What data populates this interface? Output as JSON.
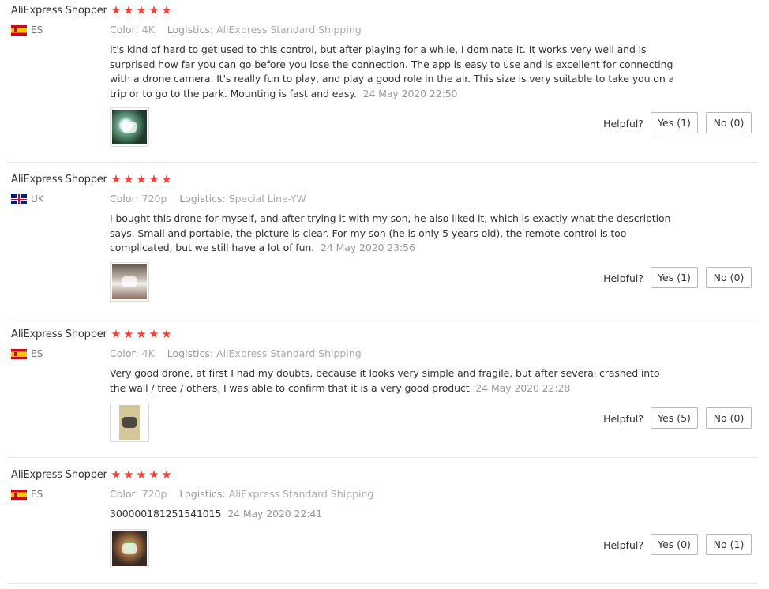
{
  "labels": {
    "color": "Color:",
    "logistics": "Logistics:",
    "helpful": "Helpful?"
  },
  "colors": {
    "star": "#f44336",
    "meta_text": "#999999",
    "body_text": "#333333",
    "button_border": "#b8b8b8"
  },
  "reviews": [
    {
      "author": "AliExpress Shopper",
      "rating": 5,
      "country": "ES",
      "flag_icon": "spain-flag-icon",
      "color": "4K",
      "logistics": "AliExpress Standard Shipping",
      "text": "It's kind of hard to get used to this control, but after playing for a while, I dominate it. It works very well and is surprised how far you can go before you lose the connection. The app is easy to use and is excellent for connecting with a drone camera. It's really fun to play, and play a good role in the air. This size is very suitable to take you on a trip or to go to the park. Mounting is fast and easy.",
      "date": "24 May 2020 22:50",
      "yes_label": "Yes (1)",
      "no_label": "No (0)"
    },
    {
      "author": "AliExpress Shopper",
      "rating": 5,
      "country": "UK",
      "flag_icon": "uk-flag-icon",
      "color": "720p",
      "logistics": "Special Line-YW",
      "text": "I bought this drone for myself, and after trying it with my son, he also liked it, which is exactly what the description says. Small and portable, the picture is clear. For my son (he is only 5 years old), the remote control is too complicated, but we still have a lot of fun.",
      "date": "24 May 2020 23:56",
      "yes_label": "Yes (1)",
      "no_label": "No (0)"
    },
    {
      "author": "AliExpress Shopper",
      "rating": 5,
      "country": "ES",
      "flag_icon": "spain-flag-icon",
      "color": "4K",
      "logistics": "AliExpress Standard Shipping",
      "text": "Very good drone, at first I had my doubts, because it looks very simple and fragile, but after several crashed into the wall / tree / others, I was able to confirm that it is a very good product",
      "date": "24 May 2020 22:28",
      "yes_label": "Yes (5)",
      "no_label": "No (0)"
    },
    {
      "author": "AliExpress Shopper",
      "rating": 5,
      "country": "ES",
      "flag_icon": "spain-flag-icon",
      "color": "720p",
      "logistics": "AliExpress Standard Shipping",
      "text": "300000181251541015",
      "date": "24 May 2020 22:41",
      "yes_label": "Yes (0)",
      "no_label": "No (1)"
    }
  ]
}
